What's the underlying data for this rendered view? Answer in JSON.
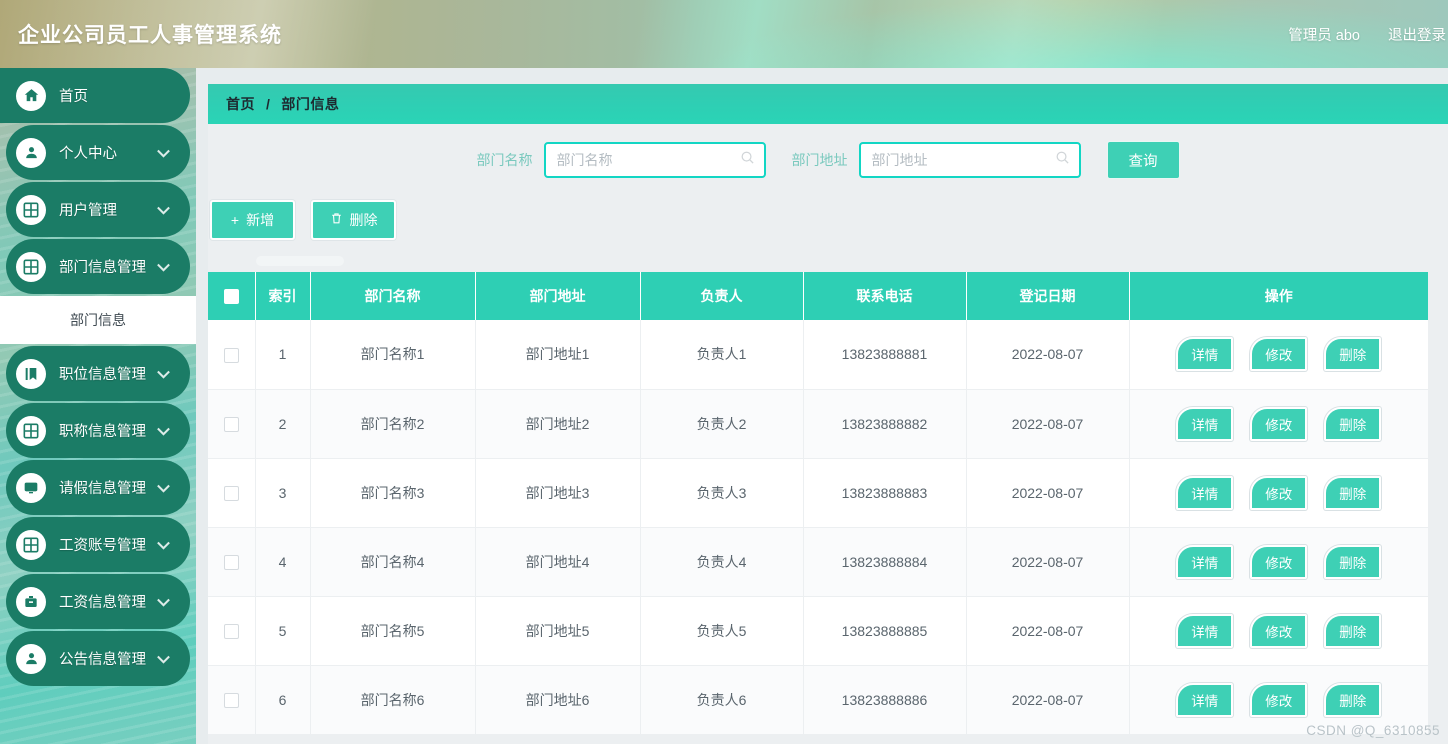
{
  "header": {
    "title": "企业公司员工人事管理系统",
    "user_label": "管理员 abo",
    "logout_label": "退出登录"
  },
  "sidebar": {
    "items": [
      {
        "label": "首页",
        "icon": "home-icon",
        "has_arrow": false,
        "active": true
      },
      {
        "label": "个人中心",
        "icon": "user-icon",
        "has_arrow": true
      },
      {
        "label": "用户管理",
        "icon": "grid-icon",
        "has_arrow": true
      },
      {
        "label": "部门信息管理",
        "icon": "grid-icon",
        "has_arrow": true,
        "expanded": true
      },
      {
        "label": "职位信息管理",
        "icon": "book-icon",
        "has_arrow": true
      },
      {
        "label": "职称信息管理",
        "icon": "grid-icon",
        "has_arrow": true
      },
      {
        "label": "请假信息管理",
        "icon": "monitor-icon",
        "has_arrow": true
      },
      {
        "label": "工资账号管理",
        "icon": "grid-icon",
        "has_arrow": true
      },
      {
        "label": "工资信息管理",
        "icon": "briefcase-icon",
        "has_arrow": true
      },
      {
        "label": "公告信息管理",
        "icon": "user-icon",
        "has_arrow": true
      }
    ],
    "submenu_label": "部门信息"
  },
  "breadcrumb": {
    "root": "首页",
    "separator": "/",
    "current": "部门信息"
  },
  "search": {
    "name_label": "部门名称",
    "name_placeholder": "部门名称",
    "name_value": "",
    "addr_label": "部门地址",
    "addr_placeholder": "部门地址",
    "addr_value": "",
    "query_label": "查询"
  },
  "toolbar": {
    "add_label": "新增",
    "add_icon": "plus-icon",
    "delete_label": "删除",
    "delete_icon": "trash-icon"
  },
  "table": {
    "columns": [
      "",
      "索引",
      "部门名称",
      "部门地址",
      "负责人",
      "联系电话",
      "登记日期",
      "操作"
    ],
    "rows": [
      {
        "index": "1",
        "name": "部门名称1",
        "address": "部门地址1",
        "head": "负责人1",
        "phone": "13823888881",
        "date": "2022-08-07"
      },
      {
        "index": "2",
        "name": "部门名称2",
        "address": "部门地址2",
        "head": "负责人2",
        "phone": "13823888882",
        "date": "2022-08-07"
      },
      {
        "index": "3",
        "name": "部门名称3",
        "address": "部门地址3",
        "head": "负责人3",
        "phone": "13823888883",
        "date": "2022-08-07"
      },
      {
        "index": "4",
        "name": "部门名称4",
        "address": "部门地址4",
        "head": "负责人4",
        "phone": "13823888884",
        "date": "2022-08-07"
      },
      {
        "index": "5",
        "name": "部门名称5",
        "address": "部门地址5",
        "head": "负责人5",
        "phone": "13823888885",
        "date": "2022-08-07"
      },
      {
        "index": "6",
        "name": "部门名称6",
        "address": "部门地址6",
        "head": "负责人6",
        "phone": "13823888886",
        "date": "2022-08-07"
      }
    ],
    "ops": {
      "detail": "详情",
      "edit": "修改",
      "delete": "删除"
    }
  },
  "watermark": "CSDN @Q_6310855",
  "colors": {
    "accent": "#2ecfb4",
    "menu": "#1b7c66",
    "button": "#3ed0b5",
    "input_border": "#12d6c4",
    "content_bg": "#eceff1"
  }
}
